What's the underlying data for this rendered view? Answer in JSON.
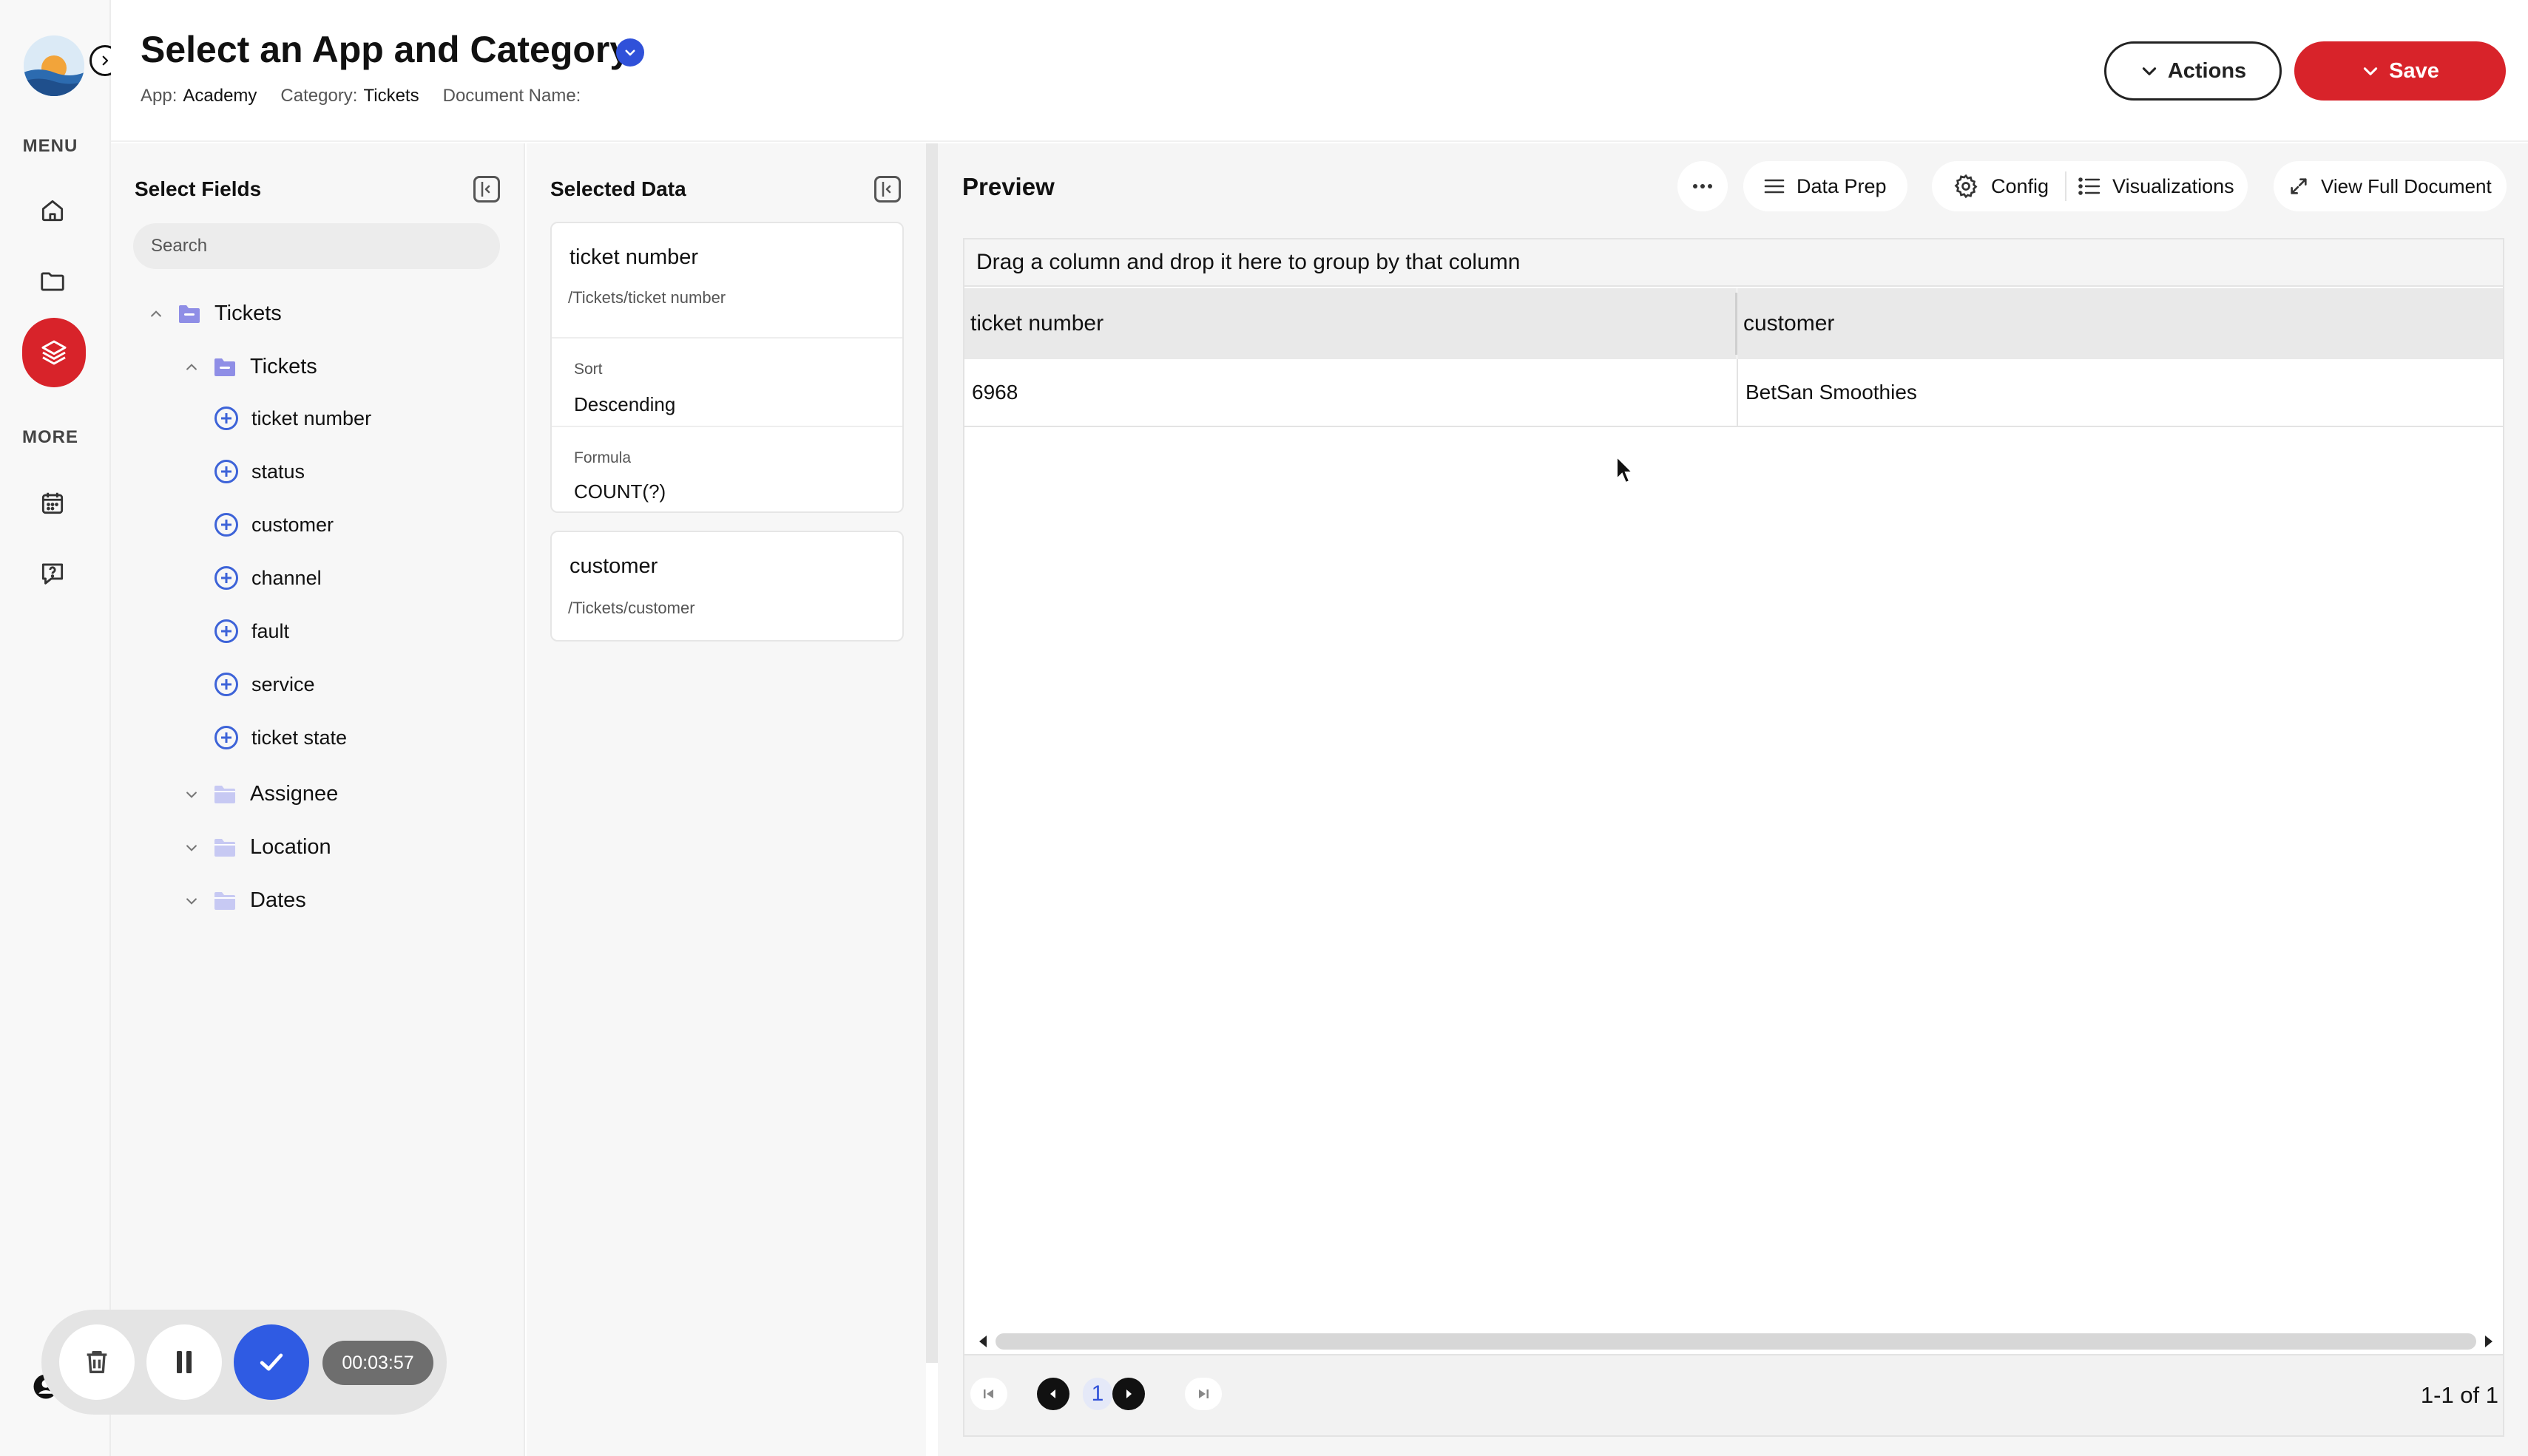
{
  "rail": {
    "menu_label": "MENU",
    "more_label": "MORE",
    "items": [
      {
        "icon": "home-icon"
      },
      {
        "icon": "folder-icon"
      },
      {
        "icon": "layers-icon",
        "active": true
      },
      {
        "icon": "calendar-icon"
      },
      {
        "icon": "help-chat-icon"
      }
    ]
  },
  "header": {
    "title": "Select an App and Category",
    "app_label": "App:",
    "app_value": "Academy",
    "category_label": "Category:",
    "category_value": "Tickets",
    "document_label": "Document Name:",
    "document_value": "",
    "actions_label": "Actions",
    "save_label": "Save"
  },
  "fields_panel": {
    "title": "Select Fields",
    "search_placeholder": "Search",
    "root": "Tickets",
    "group": "Tickets",
    "fields": [
      "ticket number",
      "status",
      "customer",
      "channel",
      "fault",
      "service",
      "ticket state"
    ],
    "collapsed_groups": [
      "Assignee",
      "Location",
      "Dates"
    ]
  },
  "selected_panel": {
    "title": "Selected Data",
    "cards": [
      {
        "title": "ticket number",
        "path": "/Tickets/ticket number",
        "sort_label": "Sort",
        "sort_value": "Descending",
        "formula_label": "Formula",
        "formula_value": "COUNT(?)"
      },
      {
        "title": "customer",
        "path": "/Tickets/customer"
      }
    ]
  },
  "preview": {
    "title": "Preview",
    "toolbar": {
      "more": "more-horizontal-icon",
      "data_prep": "Data Prep",
      "config": "Config",
      "visualizations": "Visualizations",
      "full_doc": "View Full Document"
    },
    "group_hint": "Drag a column and drop it here to group by that column",
    "columns": [
      "ticket number",
      "customer"
    ],
    "rows": [
      [
        "6968",
        "BetSan Smoothies"
      ]
    ],
    "pager": {
      "page": "1",
      "count": "1-1 of 1"
    }
  },
  "recorder": {
    "time": "00:03:57"
  },
  "colors": {
    "brand_red": "#d8232a",
    "accent_blue": "#3051d9",
    "field_plus_blue": "#3d63d8",
    "folder_purple": "#8f8ee6"
  }
}
